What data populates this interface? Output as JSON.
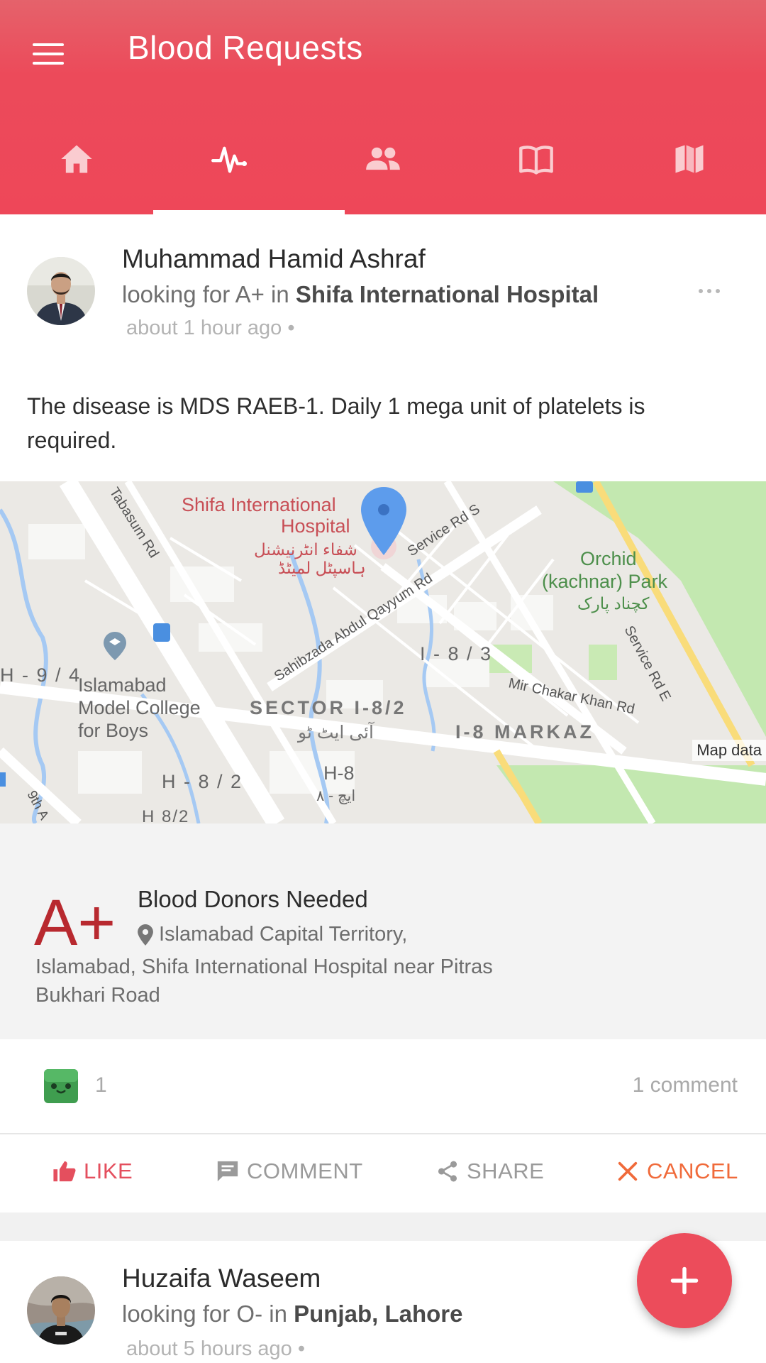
{
  "header": {
    "title": "Blood Requests",
    "menu_icon": "hamburger-menu-icon",
    "tabs": [
      {
        "icon": "home-icon",
        "selected": false
      },
      {
        "icon": "pulse-icon",
        "selected": true
      },
      {
        "icon": "people-icon",
        "selected": false
      },
      {
        "icon": "book-icon",
        "selected": false
      },
      {
        "icon": "map-icon",
        "selected": false
      }
    ]
  },
  "posts": [
    {
      "author": "Muhammad Hamid Ashraf",
      "looking_prefix": "looking for A+ in ",
      "location": "Shifa International Hospital",
      "time": "about 1 hour ago •",
      "text": "The disease is MDS RAEB-1. Daily 1 mega unit of platelets is required.",
      "map": {
        "labels": {
          "hospital_en_1": "Shifa International",
          "hospital_en_2": "Hospital",
          "hospital_ur_1": "شفاء انٹرنیشنل",
          "hospital_ur_2": "ہاسپٹل لمیٹڈ",
          "tabassum": "Tabasum Rd",
          "service_s": "Service Rd S",
          "sahibzada": "Sahibzada Abdul Qayyum Rd",
          "orchid_1": "Orchid",
          "orchid_2": "(kachnar) Park",
          "orchid_ur": "کچناد پارک",
          "i83": "I - 8 / 3",
          "service_e": "Service Rd E",
          "h94": "H - 9 / 4",
          "college_1": "Islamabad",
          "college_2": "Model College",
          "college_3": "for Boys",
          "mir": "Mir Chakar Khan Rd",
          "sector": "SECTOR I-8/2",
          "sector_ur": "آئی ایٹ ٹو",
          "markaz": "I-8 MARKAZ",
          "h8": "H-8",
          "h8_ur": "ایچ - ٨",
          "h82": "H - 8 / 2",
          "h82b": "H 8/2",
          "ninth": "9th A"
        },
        "attribution": "Map data"
      },
      "blood_type": "A+",
      "donors_title": "Blood Donors Needed",
      "address_line1": "Islamabad Capital Territory,",
      "address_rest": "Islamabad, Shifa International Hospital near Pitras Bukhari Road",
      "reaction_count": "1",
      "comment_count": "1 comment",
      "actions": {
        "like": "LIKE",
        "comment": "COMMENT",
        "share": "SHARE",
        "cancel": "CANCEL"
      }
    },
    {
      "author": "Huzaifa Waseem",
      "looking_prefix": "looking for O- in ",
      "location": "Punjab, Lahore",
      "time": "about 5 hours ago •"
    }
  ],
  "colors": {
    "primary": "#ee4759",
    "blood_type": "#b8292f",
    "like": "#e44f5e",
    "cancel": "#f06a3a"
  },
  "fab": {
    "icon": "plus-icon"
  }
}
